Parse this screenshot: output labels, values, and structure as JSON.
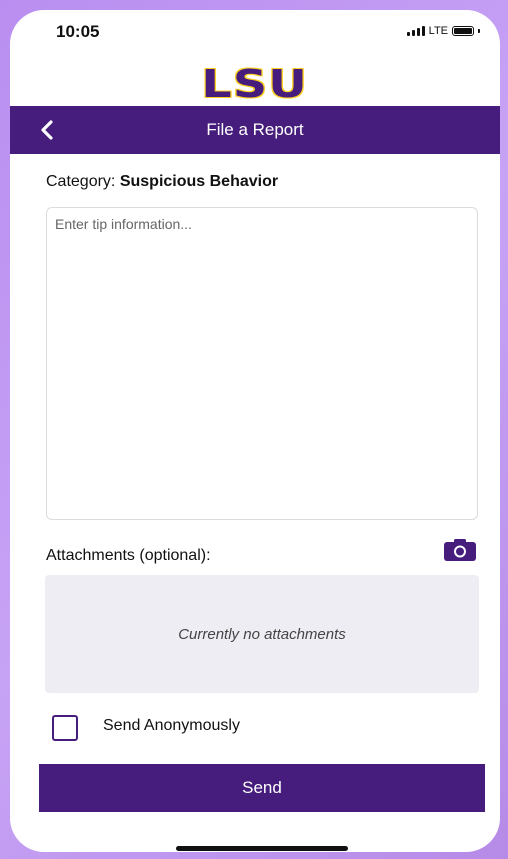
{
  "status_bar": {
    "time": "10:05",
    "network": "LTE"
  },
  "brand": {
    "logo_text": "LSU",
    "primary_color": "#461d7c",
    "accent_color": "#fdd023"
  },
  "nav": {
    "title": "File a Report",
    "back_icon": "chevron-left-icon"
  },
  "report": {
    "category_label": "Category:",
    "category_value": "Suspicious Behavior",
    "tip_placeholder": "Enter tip information...",
    "tip_value": ""
  },
  "attachments": {
    "label": "Attachments (optional):",
    "camera_icon": "camera-icon",
    "empty_text": "Currently no attachments"
  },
  "anonymous": {
    "label": "Send Anonymously",
    "checked": false
  },
  "actions": {
    "send_label": "Send"
  }
}
